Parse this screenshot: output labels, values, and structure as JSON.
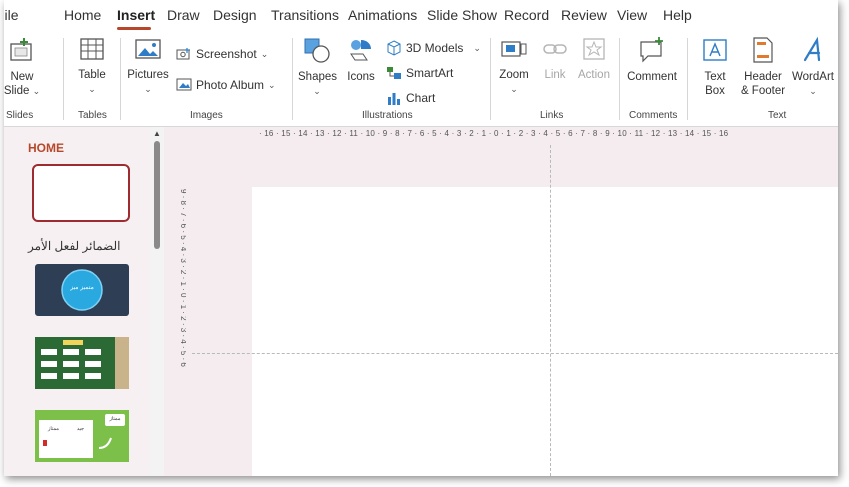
{
  "tabs": [
    "File",
    "Home",
    "Insert",
    "Draw",
    "Design",
    "Transitions",
    "Animations",
    "Slide Show",
    "Record",
    "Review",
    "View",
    "Help"
  ],
  "active_tab": "Insert",
  "ribbon": {
    "slides": {
      "new_slide": "New",
      "new_slide2": "Slide",
      "group": "Slides"
    },
    "tables": {
      "table": "Table",
      "group": "Tables"
    },
    "images": {
      "pictures": "Pictures",
      "screenshot": "Screenshot",
      "photo_album": "Photo Album",
      "group": "Images"
    },
    "illustrations": {
      "shapes": "Shapes",
      "icons": "Icons",
      "models3d": "3D Models",
      "smartart": "SmartArt",
      "chart": "Chart",
      "group": "Illustrations"
    },
    "links": {
      "zoom": "Zoom",
      "link": "Link",
      "action": "Action",
      "group": "Links"
    },
    "comments": {
      "comment": "Comment",
      "group": "Comments"
    },
    "text": {
      "text_box1": "Text",
      "text_box2": "Box",
      "header1": "Header",
      "header2": "& Footer",
      "wordart": "WordArt",
      "group": "Text"
    }
  },
  "thumbnails": {
    "section": "HOME",
    "arabic_title": "الضمائر لفعل الأمر",
    "slide2_label": "متميز ميز",
    "slide4_labels": [
      "ممتاز",
      "جيد",
      "ممتاز"
    ]
  },
  "ruler": {
    "horizontal": "· 16 · 15 · 14 · 13 · 12 · 11 · 10 · 9 · 8 · 7 · 6 · 5 · 4 · 3 · 2 · 1 · 0 · 1 · 2 · 3 · 4 · 5 · 6 · 7 · 8 · 9 · 10 · 11 · 12 · 13 · 14 · 15 · 16",
    "vertical": "9 · 8 · 7 · 6 · 5 · 4 · 3 · 2 · 1 · 0 · 1 · 2 · 3 · 4 · 5 · 6"
  },
  "colors": {
    "accent": "#b7472a",
    "selection_border": "#9e2b30",
    "workspace": "#f4ecee"
  }
}
